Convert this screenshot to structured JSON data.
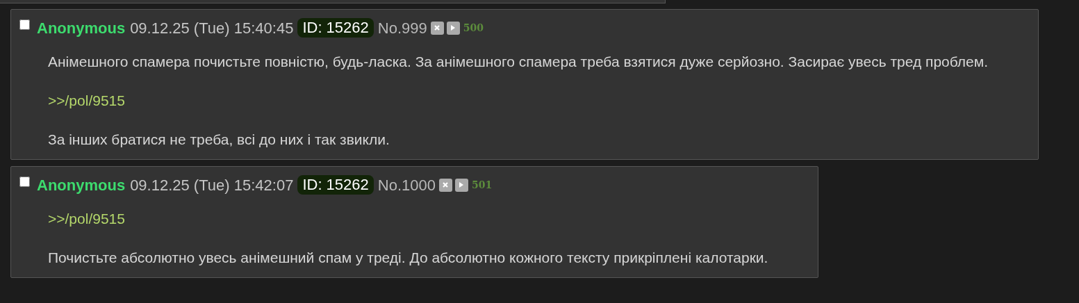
{
  "posts": [
    {
      "checked": false,
      "name": "Anonymous",
      "date": "09.12.25 (Tue) 15:40:45",
      "id": "ID: 15262",
      "number": "No.999",
      "replies": "500",
      "body": [
        {
          "kind": "text",
          "text": "Анімешного спамера почистьте повністю, будь-ласка. За анімешного спамера треба взятися дуже серйозно. Засирає увесь тред проблем."
        },
        {
          "kind": "quote",
          "text": ">>/pol/9515"
        },
        {
          "kind": "text",
          "text": "За інших братися не треба, всі до них і так звикли."
        }
      ]
    },
    {
      "checked": false,
      "name": "Anonymous",
      "date": "09.12.25 (Tue) 15:42:07",
      "id": "ID: 15262",
      "number": "No.1000",
      "replies": "501",
      "body": [
        {
          "kind": "quote",
          "text": ">>/pol/9515"
        },
        {
          "kind": "text",
          "text": "Почистьте абсолютно увесь анімешний спам у треді. До абсолютно кожного тексту прикріплені калотарки."
        }
      ]
    }
  ]
}
